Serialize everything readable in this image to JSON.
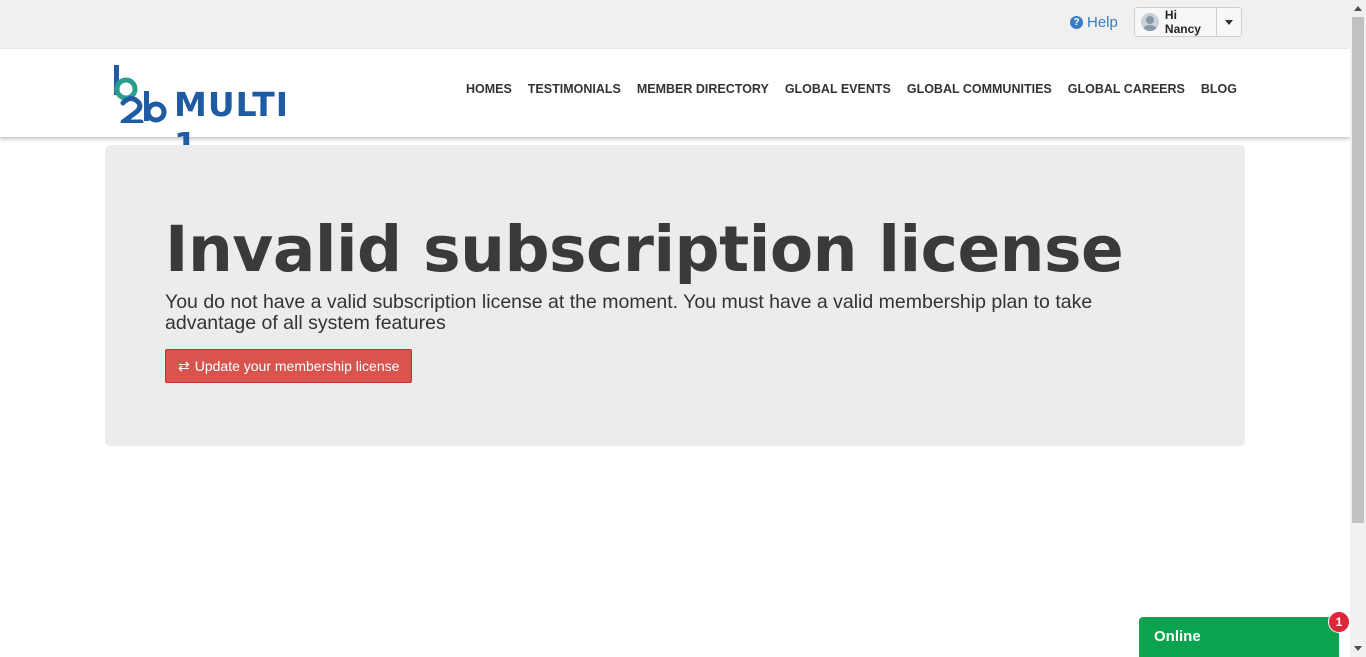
{
  "topbar": {
    "help_label": "Help",
    "user_greeting": "Hi Nancy"
  },
  "logo": {
    "mark_text": "b2b",
    "brand_text": "MULTI 1",
    "colors": {
      "mark_primary": "#1e5ba3",
      "mark_secondary": "#2a9d8f"
    }
  },
  "nav": {
    "items": [
      {
        "label": "HOMES"
      },
      {
        "label": "TESTIMONIALS"
      },
      {
        "label": "MEMBER DIRECTORY"
      },
      {
        "label": "GLOBAL EVENTS"
      },
      {
        "label": "GLOBAL COMMUNITIES"
      },
      {
        "label": "GLOBAL CAREERS"
      },
      {
        "label": "BLOG"
      }
    ]
  },
  "main": {
    "title": "Invalid subscription license",
    "message": "You do not have a valid subscription license at the moment. You must have a valid membership plan to take advantage of all system features",
    "button_label": "Update your membership license",
    "button_icon": "refresh-icon"
  },
  "chat": {
    "label": "Online",
    "badge_count": "1"
  },
  "colors": {
    "accent_link": "#3a7bc8",
    "button_danger": "#d9534f",
    "chat_green": "#0aa34f",
    "badge_red": "#e0263a"
  }
}
